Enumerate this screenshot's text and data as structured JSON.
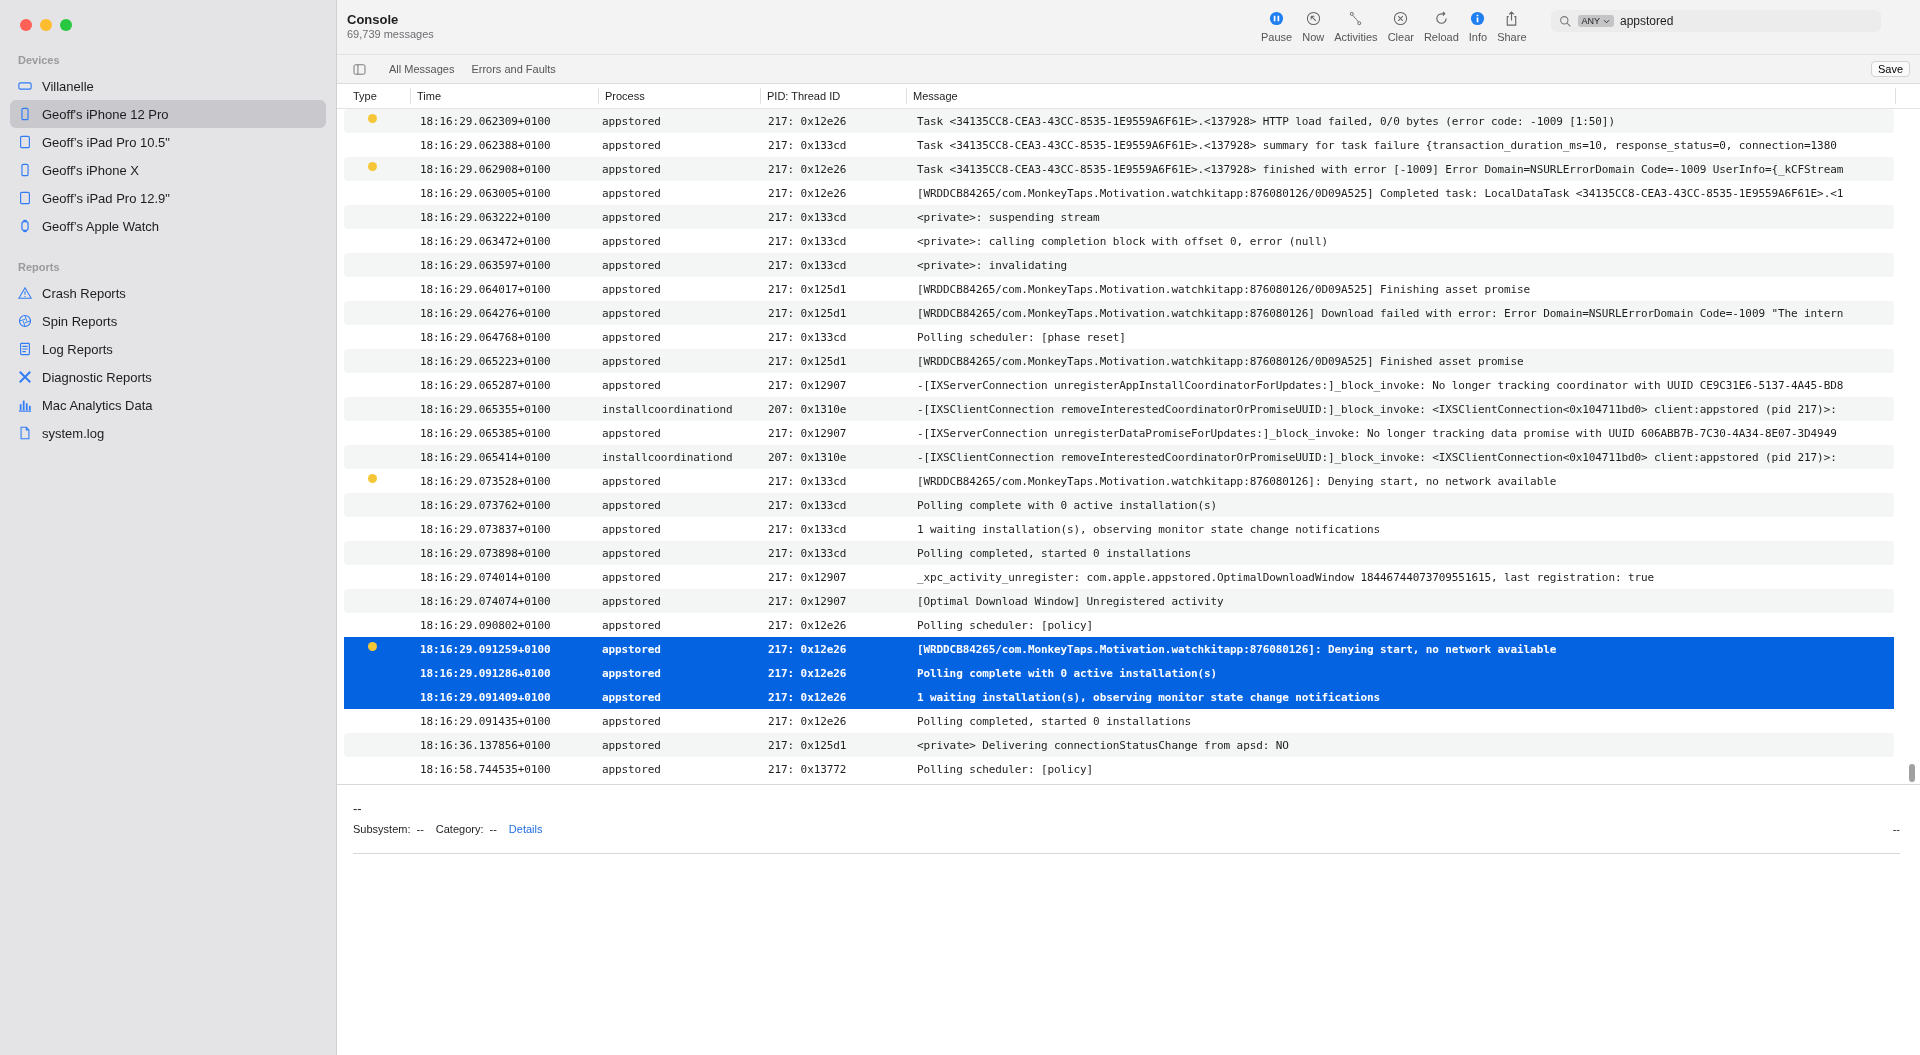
{
  "window": {
    "title": "Console",
    "subtitle": "69,739 messages"
  },
  "sidebar": {
    "sections": [
      {
        "title": "Devices",
        "items": [
          {
            "label": "Villanelle",
            "kind": "mac",
            "selected": false
          },
          {
            "label": "Geoff's iPhone 12 Pro",
            "kind": "phone",
            "selected": true
          },
          {
            "label": "Geoff’s iPad Pro 10.5\"",
            "kind": "tablet",
            "selected": false
          },
          {
            "label": "Geoff's iPhone X",
            "kind": "phone",
            "selected": false
          },
          {
            "label": "Geoff’s iPad Pro 12.9\"",
            "kind": "tablet",
            "selected": false
          },
          {
            "label": "Geoff’s Apple Watch",
            "kind": "watch",
            "selected": false
          }
        ]
      },
      {
        "title": "Reports",
        "items": [
          {
            "label": "Crash Reports",
            "kind": "warning",
            "selected": false
          },
          {
            "label": "Spin Reports",
            "kind": "spin",
            "selected": false
          },
          {
            "label": "Log Reports",
            "kind": "log",
            "selected": false
          },
          {
            "label": "Diagnostic Reports",
            "kind": "tools",
            "selected": false
          },
          {
            "label": "Mac Analytics Data",
            "kind": "chart",
            "selected": false
          },
          {
            "label": "system.log",
            "kind": "file",
            "selected": false
          }
        ]
      }
    ]
  },
  "toolbar": [
    {
      "label": "Pause",
      "kind": "pause",
      "active": true
    },
    {
      "label": "Now",
      "kind": "now",
      "active": false
    },
    {
      "label": "Activities",
      "kind": "activities",
      "active": false
    },
    {
      "label": "Clear",
      "kind": "clear",
      "active": false
    },
    {
      "label": "Reload",
      "kind": "reload",
      "active": false
    },
    {
      "label": "Info",
      "kind": "info",
      "active": true
    },
    {
      "label": "Share",
      "kind": "share",
      "active": false
    }
  ],
  "search": {
    "scope": "ANY",
    "value": "appstored"
  },
  "filters": [
    {
      "label": "All Messages"
    },
    {
      "label": "Errors and Faults"
    }
  ],
  "save_button": "Save",
  "table": {
    "columns": [
      "Type",
      "Time",
      "Process",
      "PID: Thread ID",
      "Message"
    ],
    "rows": [
      {
        "kind": "error",
        "time": "18:16:29.062309+0100",
        "process": "appstored",
        "thread": "217: 0x12e26",
        "message": "Task <34135CC8-CEA3-43CC-8535-1E9559A6F61E>.<137928> HTTP load failed, 0/0 bytes (error code: -1009 [1:50])",
        "selected": false
      },
      {
        "kind": "default",
        "time": "18:16:29.062388+0100",
        "process": "appstored",
        "thread": "217: 0x133cd",
        "message": "Task <34135CC8-CEA3-43CC-8535-1E9559A6F61E>.<137928> summary for task failure {transaction_duration_ms=10, response_status=0, connection=1380",
        "selected": false
      },
      {
        "kind": "error",
        "time": "18:16:29.062908+0100",
        "process": "appstored",
        "thread": "217: 0x12e26",
        "message": "Task <34135CC8-CEA3-43CC-8535-1E9559A6F61E>.<137928> finished with error [-1009] Error Domain=NSURLErrorDomain Code=-1009 UserInfo={_kCFStream",
        "selected": false
      },
      {
        "kind": "default",
        "time": "18:16:29.063005+0100",
        "process": "appstored",
        "thread": "217: 0x12e26",
        "message": "[WRDDCB84265/com.MonkeyTaps.Motivation.watchkitapp:876080126/0D09A525] Completed task: LocalDataTask <34135CC8-CEA3-43CC-8535-1E9559A6F61E>.<1",
        "selected": false
      },
      {
        "kind": "default",
        "time": "18:16:29.063222+0100",
        "process": "appstored",
        "thread": "217: 0x133cd",
        "message": "<private>: suspending stream",
        "selected": false
      },
      {
        "kind": "default",
        "time": "18:16:29.063472+0100",
        "process": "appstored",
        "thread": "217: 0x133cd",
        "message": "<private>: calling completion block with offset 0, error (null)",
        "selected": false
      },
      {
        "kind": "default",
        "time": "18:16:29.063597+0100",
        "process": "appstored",
        "thread": "217: 0x133cd",
        "message": "<private>: invalidating",
        "selected": false
      },
      {
        "kind": "default",
        "time": "18:16:29.064017+0100",
        "process": "appstored",
        "thread": "217: 0x125d1",
        "message": "[WRDDCB84265/com.MonkeyTaps.Motivation.watchkitapp:876080126/0D09A525] Finishing asset promise",
        "selected": false
      },
      {
        "kind": "default",
        "time": "18:16:29.064276+0100",
        "process": "appstored",
        "thread": "217: 0x125d1",
        "message": "[WRDDCB84265/com.MonkeyTaps.Motivation.watchkitapp:876080126] Download failed with error: Error Domain=NSURLErrorDomain Code=-1009 \"The intern",
        "selected": false
      },
      {
        "kind": "default",
        "time": "18:16:29.064768+0100",
        "process": "appstored",
        "thread": "217: 0x133cd",
        "message": "Polling scheduler: [phase reset]",
        "selected": false
      },
      {
        "kind": "default",
        "time": "18:16:29.065223+0100",
        "process": "appstored",
        "thread": "217: 0x125d1",
        "message": "[WRDDCB84265/com.MonkeyTaps.Motivation.watchkitapp:876080126/0D09A525] Finished asset promise",
        "selected": false
      },
      {
        "kind": "default",
        "time": "18:16:29.065287+0100",
        "process": "appstored",
        "thread": "217: 0x12907",
        "message": "-[IXServerConnection unregisterAppInstallCoordinatorForUpdates:]_block_invoke: No longer tracking coordinator with UUID CE9C31E6-5137-4A45-BD8",
        "selected": false
      },
      {
        "kind": "default",
        "time": "18:16:29.065355+0100",
        "process": "installcoordinationd",
        "thread": "207: 0x1310e",
        "message": "-[IXSClientConnection removeInterestedCoordinatorOrPromiseUUID:]_block_invoke: <IXSClientConnection<0x104711bd0> client:appstored (pid 217)>:",
        "selected": false
      },
      {
        "kind": "default",
        "time": "18:16:29.065385+0100",
        "process": "appstored",
        "thread": "217: 0x12907",
        "message": "-[IXServerConnection unregisterDataPromiseForUpdates:]_block_invoke: No longer tracking data promise with UUID 606ABB7B-7C30-4A34-8E07-3D4949",
        "selected": false
      },
      {
        "kind": "default",
        "time": "18:16:29.065414+0100",
        "process": "installcoordinationd",
        "thread": "207: 0x1310e",
        "message": "-[IXSClientConnection removeInterestedCoordinatorOrPromiseUUID:]_block_invoke: <IXSClientConnection<0x104711bd0> client:appstored (pid 217)>:",
        "selected": false
      },
      {
        "kind": "error",
        "time": "18:16:29.073528+0100",
        "process": "appstored",
        "thread": "217: 0x133cd",
        "message": "[WRDDCB84265/com.MonkeyTaps.Motivation.watchkitapp:876080126]: Denying start, no network available",
        "selected": false
      },
      {
        "kind": "default",
        "time": "18:16:29.073762+0100",
        "process": "appstored",
        "thread": "217: 0x133cd",
        "message": "Polling complete with 0 active installation(s)",
        "selected": false
      },
      {
        "kind": "default",
        "time": "18:16:29.073837+0100",
        "process": "appstored",
        "thread": "217: 0x133cd",
        "message": "1 waiting installation(s), observing monitor state change notifications",
        "selected": false
      },
      {
        "kind": "default",
        "time": "18:16:29.073898+0100",
        "process": "appstored",
        "thread": "217: 0x133cd",
        "message": "Polling completed, started 0 installations",
        "selected": false
      },
      {
        "kind": "default",
        "time": "18:16:29.074014+0100",
        "process": "appstored",
        "thread": "217: 0x12907",
        "message": "_xpc_activity_unregister: com.apple.appstored.OptimalDownloadWindow 18446744073709551615, last registration: true",
        "selected": false
      },
      {
        "kind": "default",
        "time": "18:16:29.074074+0100",
        "process": "appstored",
        "thread": "217: 0x12907",
        "message": "[Optimal Download Window] Unregistered activity",
        "selected": false
      },
      {
        "kind": "default",
        "time": "18:16:29.090802+0100",
        "process": "appstored",
        "thread": "217: 0x12e26",
        "message": "Polling scheduler: [policy]",
        "selected": false
      },
      {
        "kind": "error",
        "time": "18:16:29.091259+0100",
        "process": "appstored",
        "thread": "217: 0x12e26",
        "message": "[WRDDCB84265/com.MonkeyTaps.Motivation.watchkitapp:876080126]: Denying start, no network available",
        "selected": true
      },
      {
        "kind": "default",
        "time": "18:16:29.091286+0100",
        "process": "appstored",
        "thread": "217: 0x12e26",
        "message": "Polling complete with 0 active installation(s)",
        "selected": true
      },
      {
        "kind": "default",
        "time": "18:16:29.091409+0100",
        "process": "appstored",
        "thread": "217: 0x12e26",
        "message": "1 waiting installation(s), observing monitor state change notifications",
        "selected": true
      },
      {
        "kind": "default",
        "time": "18:16:29.091435+0100",
        "process": "appstored",
        "thread": "217: 0x12e26",
        "message": "Polling completed, started 0 installations",
        "selected": false
      },
      {
        "kind": "default",
        "time": "18:16:36.137856+0100",
        "process": "appstored",
        "thread": "217: 0x125d1",
        "message": "<private> Delivering connectionStatusChange from apsd: NO",
        "selected": false
      },
      {
        "kind": "default",
        "time": "18:16:58.744535+0100",
        "process": "appstored",
        "thread": "217: 0x13772",
        "message": "Polling scheduler: [policy]",
        "selected": false
      }
    ]
  },
  "detail": {
    "title": "--",
    "subsystem_label": "Subsystem:",
    "subsystem": "--",
    "category_label": "Category:",
    "category": "--",
    "details_link": "Details",
    "right": "--"
  }
}
